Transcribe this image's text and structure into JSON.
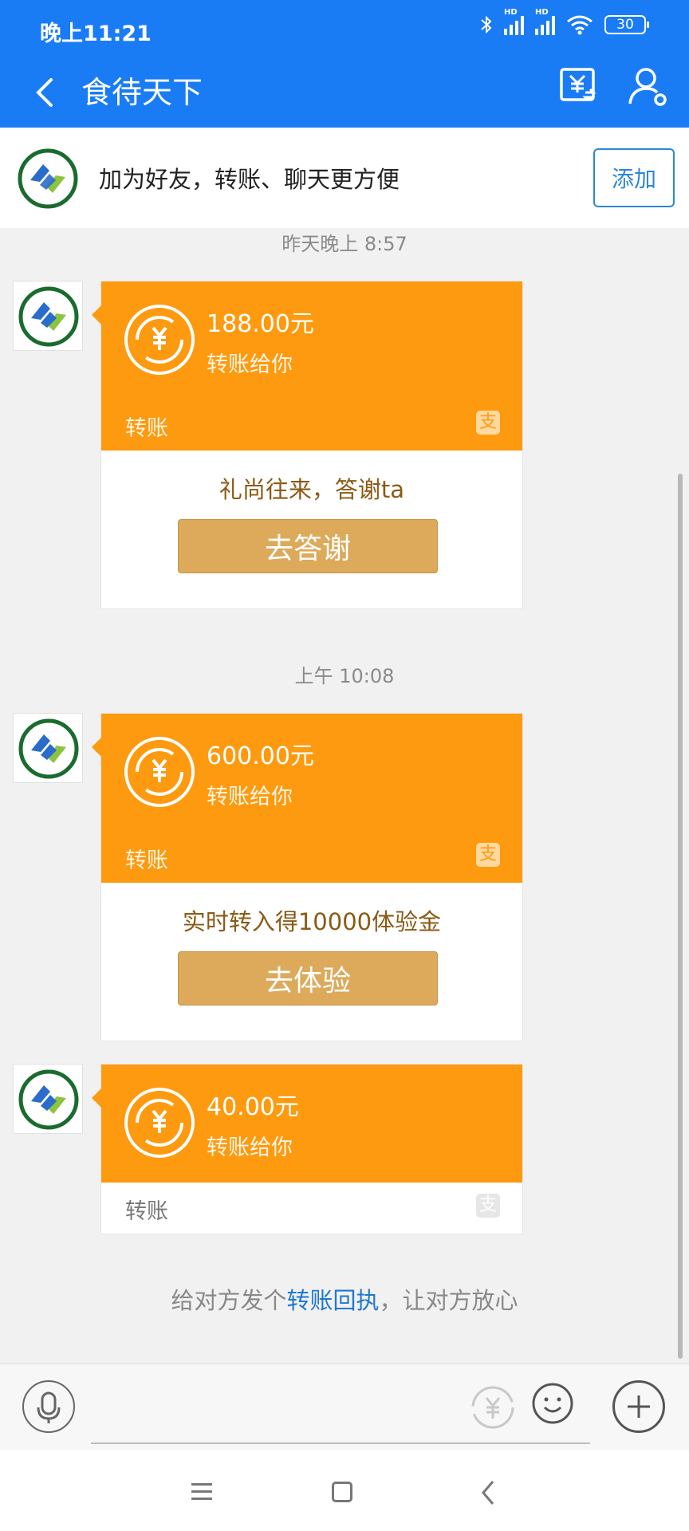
{
  "status_bar": {
    "time": "晚上11:21",
    "network_1": "HD",
    "network_2": "HD",
    "battery": "30"
  },
  "nav": {
    "title": "食待天下",
    "back_icon": "chevron-left-icon",
    "transfer_icon": "transfer-icon",
    "profile_icon": "person-settings-icon"
  },
  "banner": {
    "text": "加为好友，转账、聊天更方便",
    "add_button": "添加"
  },
  "messages": [
    {
      "timestamp": "昨天晚上 8:57",
      "amount": "188.00元",
      "subtitle": "转账给你",
      "label": "转账",
      "promo": "礼尚往来，答谢ta",
      "action": "去答谢"
    },
    {
      "timestamp": "上午 10:08",
      "amount": "600.00元",
      "subtitle": "转账给你",
      "label": "转账",
      "promo": "实时转入得10000体验金",
      "action": "去体验"
    },
    {
      "amount": "40.00元",
      "subtitle": "转账给你",
      "label": "转账"
    }
  ],
  "receipt": {
    "prefix": "给对方发个",
    "link": "转账回执",
    "suffix": "，让对方放心"
  },
  "input": {
    "placeholder": ""
  },
  "colors": {
    "header_blue": "#1a7cf5",
    "card_orange": "#fd9a0f",
    "action_gold": "#dcaa5a",
    "link_blue": "#1f78d1"
  }
}
